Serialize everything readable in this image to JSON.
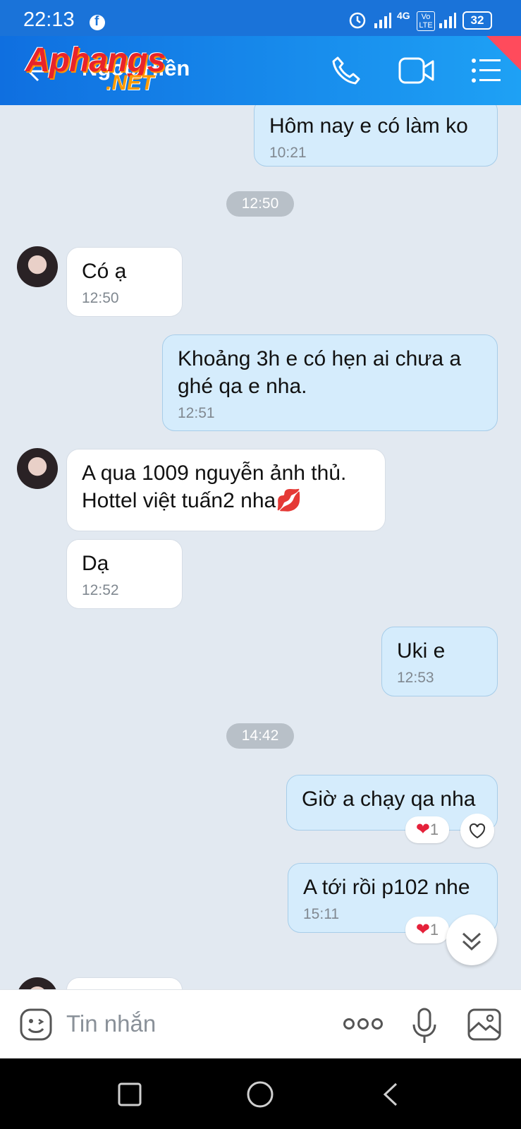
{
  "status_bar": {
    "time": "22:13",
    "network": "4G",
    "volte": "Vo LTE",
    "battery": "32"
  },
  "header": {
    "contact_name": "Ngọc Hiền",
    "watermark_line1": "Aphangs",
    "watermark_line2": ".NET"
  },
  "messages": [
    {
      "dir": "out",
      "text": "Hôm nay e có làm ko",
      "time": "10:21"
    },
    {
      "type": "sep",
      "text": "12:50"
    },
    {
      "dir": "in",
      "text": "Có ạ",
      "time": "12:50"
    },
    {
      "dir": "out",
      "text": "Khoảng 3h e có hẹn ai chưa a ghé qa e nha.",
      "time": "12:51"
    },
    {
      "dir": "in",
      "text": "A qua 1009 nguyễn ảnh thủ. Hottel việt tuấn2 nha💋",
      "time": ""
    },
    {
      "dir": "in",
      "text": "Dạ",
      "time": "12:52"
    },
    {
      "dir": "out",
      "text": "Uki e",
      "time": "12:53"
    },
    {
      "type": "sep",
      "text": "14:42"
    },
    {
      "dir": "out",
      "text": "Giờ a chạy qa nha",
      "time": "",
      "reaction_count": "1"
    },
    {
      "dir": "out",
      "text": "A tới rồi p102 nhe",
      "time": "15:11",
      "reaction_count": "1"
    }
  ],
  "input": {
    "placeholder": "Tin nhắn"
  },
  "icons": {
    "back": "back-arrow-icon",
    "call": "phone-icon",
    "video": "video-icon",
    "menu": "menu-list-icon",
    "sticker": "sticker-icon",
    "more": "more-dots-icon",
    "mic": "mic-icon",
    "image": "image-icon",
    "reaction": "heart-icon",
    "scroll": "double-chevron-down-icon"
  },
  "colors": {
    "header": "#1a73d9",
    "outgoing_bubble": "#d5ecfc",
    "incoming_bubble": "#ffffff",
    "chat_bg": "#e2e9f1",
    "heart": "#e5213a"
  }
}
